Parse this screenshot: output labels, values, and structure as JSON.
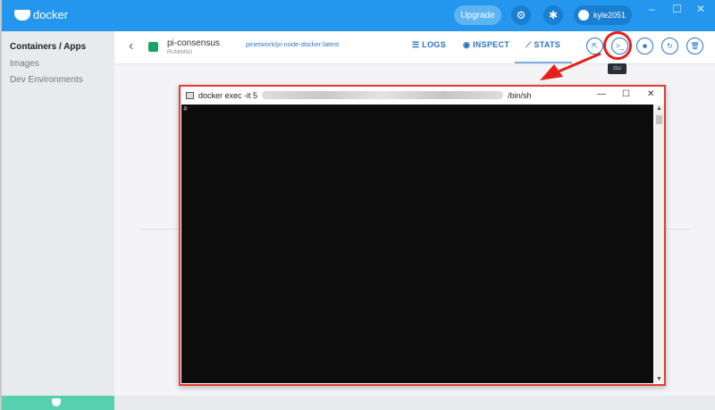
{
  "titlebar": {
    "app_name": "docker",
    "upgrade_label": "Upgrade",
    "username": "kyle2051",
    "minimize": "–",
    "maximize": "☐",
    "close": "✕"
  },
  "sidebar": {
    "items": [
      {
        "label": "Containers / Apps",
        "active": true
      },
      {
        "label": "Images"
      },
      {
        "label": "Dev Environments"
      }
    ]
  },
  "container": {
    "name": "pi-consensus",
    "image": "pinetwork/pi-node-docker:latest",
    "status": "RUNNING"
  },
  "tabs": [
    {
      "label": "LOGS",
      "icon": "list-icon"
    },
    {
      "label": "INSPECT",
      "icon": "eye-icon"
    },
    {
      "label": "STATS",
      "icon": "chart-icon",
      "active": true
    }
  ],
  "actions": {
    "open_browser": "⇱",
    "cli": ">_",
    "stop": "■",
    "restart": "↻",
    "delete": "🗑",
    "cli_tooltip": "CLI"
  },
  "terminal": {
    "title_prefix": "docker exec -it 5",
    "title_suffix": "/bin/sh",
    "prompt": "#",
    "minimize": "—",
    "maximize": "☐",
    "close": "✕",
    "scroll_up": "▲",
    "scroll_down": "▼"
  },
  "colors": {
    "brand": "#2496ed",
    "highlight": "#e5201b",
    "running": "#19a463"
  }
}
